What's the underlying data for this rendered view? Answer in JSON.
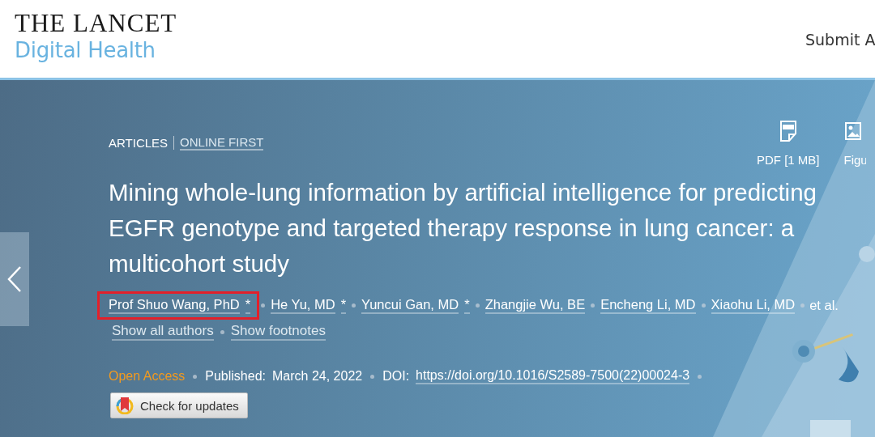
{
  "header": {
    "logo_top": "THE LANCET",
    "logo_bottom": "Digital Health",
    "nav_link": "Submit A"
  },
  "article": {
    "section": "ARTICLES",
    "subsection": "ONLINE FIRST",
    "tools": [
      {
        "kind": "pdf",
        "label": "PDF [1 MB]"
      },
      {
        "kind": "figures",
        "label": "Figu"
      }
    ],
    "title": "Mining whole-lung information by artificial intelligence for predicting EGFR genotype and targeted therapy response in lung cancer: a multicohort study",
    "authors": [
      {
        "name": "Prof Shuo Wang, PhD",
        "mark": "*",
        "highlighted": true
      },
      {
        "name": "He Yu, MD",
        "mark": "*",
        "highlighted": false
      },
      {
        "name": "Yuncui Gan, MD",
        "mark": "*",
        "highlighted": false
      },
      {
        "name": "Zhangjie Wu, BE",
        "highlighted": false
      },
      {
        "name": "Encheng Li, MD",
        "highlighted": false
      },
      {
        "name": "Xiaohu Li, MD",
        "highlighted": false
      }
    ],
    "et_al": "et al.",
    "author_links": [
      "Show all authors",
      "Show footnotes"
    ],
    "access": "Open Access",
    "published_label": "Published:",
    "published_date": "March 24, 2022",
    "doi_label": "DOI:",
    "doi": "https://doi.org/10.1016/S2589-7500(22)00024-3",
    "updates_button": "Check for updates"
  }
}
